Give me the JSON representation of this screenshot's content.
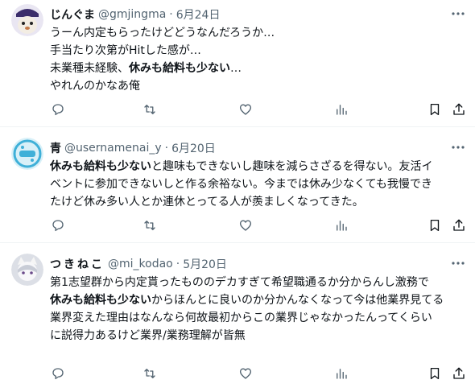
{
  "tweets": [
    {
      "name": "じんぐま",
      "handle": "@gmjingma",
      "separator": "·",
      "date": "6月24日",
      "lines": [
        {
          "parts": [
            {
              "text": "うーん内定もらったけどどうなんだろうか…",
              "bold": false
            }
          ]
        },
        {
          "parts": [
            {
              "text": "手当たり次第がHitした感が…",
              "bold": false
            }
          ]
        },
        {
          "parts": [
            {
              "text": "未業種未経験、",
              "bold": false
            },
            {
              "text": "休みも給料も少ない",
              "bold": true
            },
            {
              "text": "…",
              "bold": false
            }
          ]
        },
        {
          "parts": [
            {
              "text": "やれんのかなあ俺",
              "bold": false
            }
          ]
        }
      ]
    },
    {
      "name": "青",
      "handle": "@usernamenai_y",
      "separator": "·",
      "date": "6月20日",
      "lines": [
        {
          "parts": [
            {
              "text": "休みも給料も少ない",
              "bold": true
            },
            {
              "text": "と趣味もできないし趣味を減らさざるを得ない。友活イ",
              "bold": false
            }
          ]
        },
        {
          "parts": [
            {
              "text": "ベントに参加できないしと作る余裕ない。今までは休み少なくても我慢でき",
              "bold": false
            }
          ]
        },
        {
          "parts": [
            {
              "text": "たけど休み多い人とか連休とってる人が羨ましくなってきた。",
              "bold": false
            }
          ]
        }
      ]
    },
    {
      "name": "つきねこ",
      "handle": "@mi_kodao",
      "separator": "·",
      "date": "5月20日",
      "lines": [
        {
          "parts": [
            {
              "text": "第1志望群から内定貰ったもののデカすぎて希望職通るか分からんし激務で",
              "bold": false
            }
          ]
        },
        {
          "parts": [
            {
              "text": "休みも給料も少ない",
              "bold": true
            },
            {
              "text": "からほんとに良いのか分かんなくなって今は他業界見てる",
              "bold": false
            }
          ]
        },
        {
          "parts": [
            {
              "text": "業界変えた理由はなんなら何故最初からこの業界じゃなかったんってくらい",
              "bold": false
            }
          ]
        },
        {
          "parts": [
            {
              "text": "に説得力あるけど業界/業務理解が皆無",
              "bold": false
            }
          ]
        }
      ]
    }
  ],
  "icons": {
    "more": "more-dots-icon",
    "reply": "reply-bubble-icon",
    "retweet": "retweet-arrows-icon",
    "like": "heart-icon",
    "views": "bar-chart-icon",
    "bookmark": "bookmark-icon",
    "share": "share-arrow-icon"
  },
  "colors": {
    "text": "#0f1419",
    "secondary": "#536471",
    "divider": "#eff3f4",
    "avatar1": "#3b2d6b",
    "avatar2": "#3fb0d8",
    "avatar3": "#dcdfe6"
  }
}
